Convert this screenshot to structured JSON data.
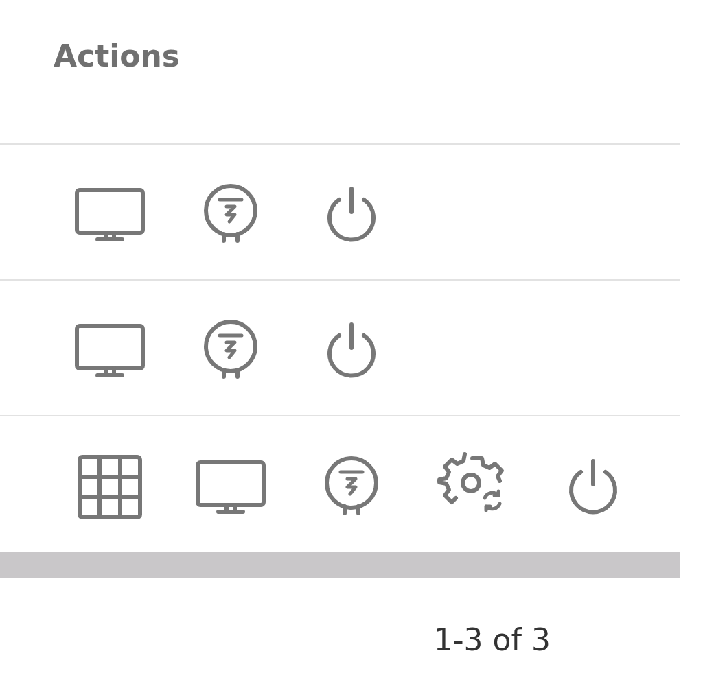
{
  "table": {
    "columns": [
      {
        "label": "Actions"
      }
    ],
    "rows": [
      {
        "actions": [
          {
            "kind": "monitor"
          },
          {
            "kind": "meter"
          },
          {
            "kind": "power"
          }
        ]
      },
      {
        "actions": [
          {
            "kind": "monitor"
          },
          {
            "kind": "meter"
          },
          {
            "kind": "power"
          }
        ]
      },
      {
        "actions": [
          {
            "kind": "grid"
          },
          {
            "kind": "monitor"
          },
          {
            "kind": "meter"
          },
          {
            "kind": "gear-sync"
          },
          {
            "kind": "power"
          }
        ]
      }
    ]
  },
  "pagination": {
    "range": "1-3 of 3"
  }
}
